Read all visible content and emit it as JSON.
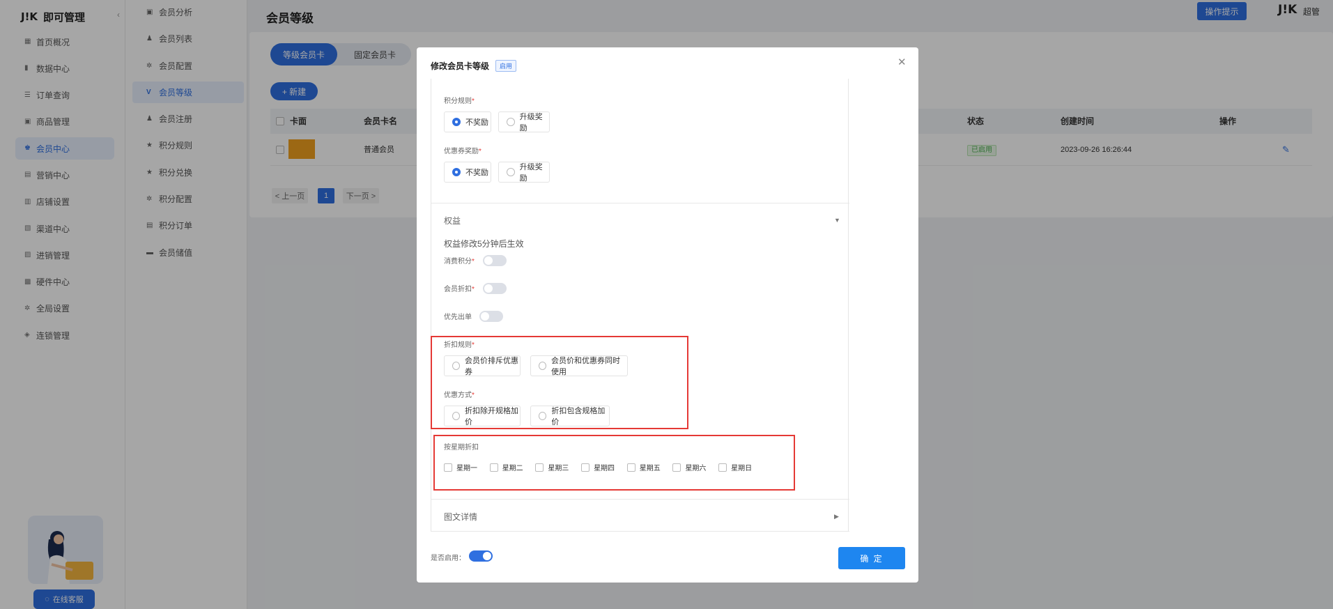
{
  "app": {
    "logo": "J!K",
    "name": "即可管理"
  },
  "nav": {
    "items": [
      {
        "label": "首页概况",
        "icon": "grid-icon"
      },
      {
        "label": "数据中心",
        "icon": "bar-chart-icon"
      },
      {
        "label": "订单查询",
        "icon": "list-icon"
      },
      {
        "label": "商品管理",
        "icon": "box-icon"
      },
      {
        "label": "会员中心",
        "icon": "member-icon"
      },
      {
        "label": "营销中心",
        "icon": "gift-icon"
      },
      {
        "label": "店铺设置",
        "icon": "store-icon"
      },
      {
        "label": "渠道中心",
        "icon": "channel-icon"
      },
      {
        "label": "进销管理",
        "icon": "stock-icon"
      },
      {
        "label": "硬件中心",
        "icon": "device-icon"
      },
      {
        "label": "全局设置",
        "icon": "gear-icon"
      },
      {
        "label": "连锁管理",
        "icon": "shield-icon"
      }
    ],
    "active": "会员中心"
  },
  "subnav": {
    "items": [
      {
        "label": "会员分析",
        "icon": "chart-icon"
      },
      {
        "label": "会员列表",
        "icon": "user-icon"
      },
      {
        "label": "会员配置",
        "icon": "gear-icon"
      },
      {
        "label": "会员等级",
        "icon": "v-icon"
      },
      {
        "label": "会员注册",
        "icon": "user-add-icon"
      },
      {
        "label": "积分规则",
        "icon": "star-icon"
      },
      {
        "label": "积分兑换",
        "icon": "star-icon"
      },
      {
        "label": "积分配置",
        "icon": "gear-icon"
      },
      {
        "label": "积分订单",
        "icon": "order-icon"
      },
      {
        "label": "会员储值",
        "icon": "wallet-icon"
      }
    ],
    "active": "会员等级"
  },
  "chat_button": "在线客服",
  "header": {
    "title": "会员等级",
    "tip_button": "操作提示",
    "user": "超管",
    "logo": "J!K"
  },
  "tabs": {
    "a": "等级会员卡",
    "b": "固定会员卡"
  },
  "new_button": "+ 新建",
  "table": {
    "headers": {
      "card": "卡面",
      "name": "会员卡名",
      "status": "状态",
      "created": "创建时间",
      "ops": "操作"
    },
    "row": {
      "name": "普通会员",
      "status": "已启用",
      "created": "2023-09-26 16:26:44"
    }
  },
  "pager": {
    "prev": "< 上一页",
    "page": "1",
    "next": "下一页 >"
  },
  "modal": {
    "title": "修改会员卡等级",
    "tag": "启用",
    "points_rule": {
      "label": "积分规则",
      "opt1": "不奖励",
      "opt2": "升级奖励",
      "selected": "不奖励"
    },
    "coupon_reward": {
      "label": "优惠券奖励",
      "opt1": "不奖励",
      "opt2": "升级奖励",
      "selected": "不奖励"
    },
    "benefits": {
      "title": "权益",
      "note": "权益修改5分钟后生效",
      "consume_points": {
        "label": "消费积分",
        "on": false
      },
      "member_discount": {
        "label": "会员折扣",
        "on": false
      },
      "priority": {
        "label": "优先出单",
        "on": false
      }
    },
    "discount_rule": {
      "label": "折扣规则",
      "opt1": "会员价排斥优惠券",
      "opt2": "会员价和优惠券同时使用"
    },
    "discount_mode": {
      "label": "优惠方式",
      "opt1": "折扣除开规格加价",
      "opt2": "折扣包含规格加价"
    },
    "weekday": {
      "label": "按星期折扣",
      "days": [
        "星期一",
        "星期二",
        "星期三",
        "星期四",
        "星期五",
        "星期六",
        "星期日"
      ]
    },
    "detail": {
      "title": "图文详情"
    },
    "enable": {
      "label": "是否启用：",
      "on": true
    },
    "ok_button": "确 定",
    "colors": {
      "primary": "#2f6fe0",
      "highlight": "#e53935"
    }
  }
}
